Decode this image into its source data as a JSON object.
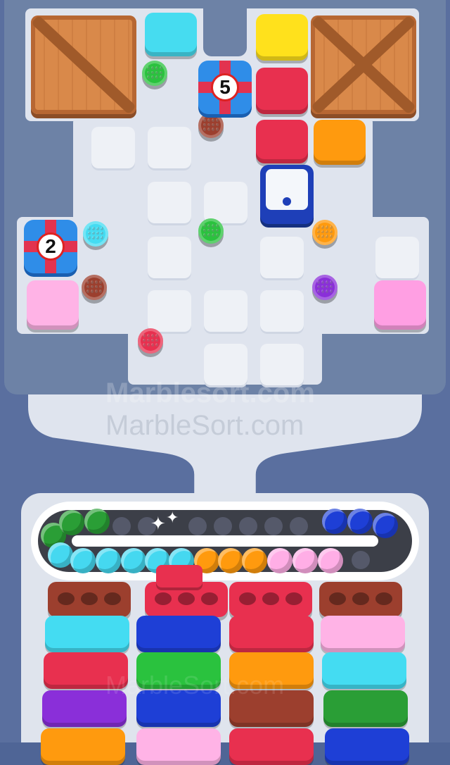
{
  "colors": {
    "frame": "#5a6f9f",
    "board": "#6d82a6",
    "crate": "#d9894a",
    "cyan": "#44dcf2",
    "green": "#2ac23e",
    "red": "#e8304f",
    "yellow": "#ffe21a",
    "orange": "#ff9a0e",
    "brown": "#9c3f2e",
    "blue": "#1e3fb8",
    "purple": "#8a2fd9",
    "pink": "#ffb3e6",
    "lightpink": "#ff9fe3"
  },
  "board": {
    "gift_top_number": "5",
    "gift_left_number": "2"
  },
  "conveyor": {
    "top_marbles": [
      "green",
      "green",
      "green",
      "green",
      "blue",
      "blue",
      "blue"
    ],
    "bottom_marbles": [
      "cyan",
      "cyan",
      "cyan",
      "cyan",
      "cyan",
      "cyan",
      "orange",
      "orange",
      "orange",
      "pink",
      "pink",
      "pink"
    ]
  },
  "columns": [
    {
      "cap": "brown",
      "stack": [
        "cyan",
        "red",
        "purple"
      ]
    },
    {
      "cap": "red",
      "stack": [
        "blue",
        "green",
        "blue"
      ]
    },
    {
      "cap": "red",
      "stack": [
        "red",
        "orange",
        "brown"
      ]
    },
    {
      "cap": "brown",
      "stack": [
        "pink",
        "cyan",
        "green"
      ]
    }
  ],
  "watermark": {
    "line1": "Marblesort.com",
    "line2": "MarbleSort.com",
    "line3": "MarbleSort.com"
  }
}
